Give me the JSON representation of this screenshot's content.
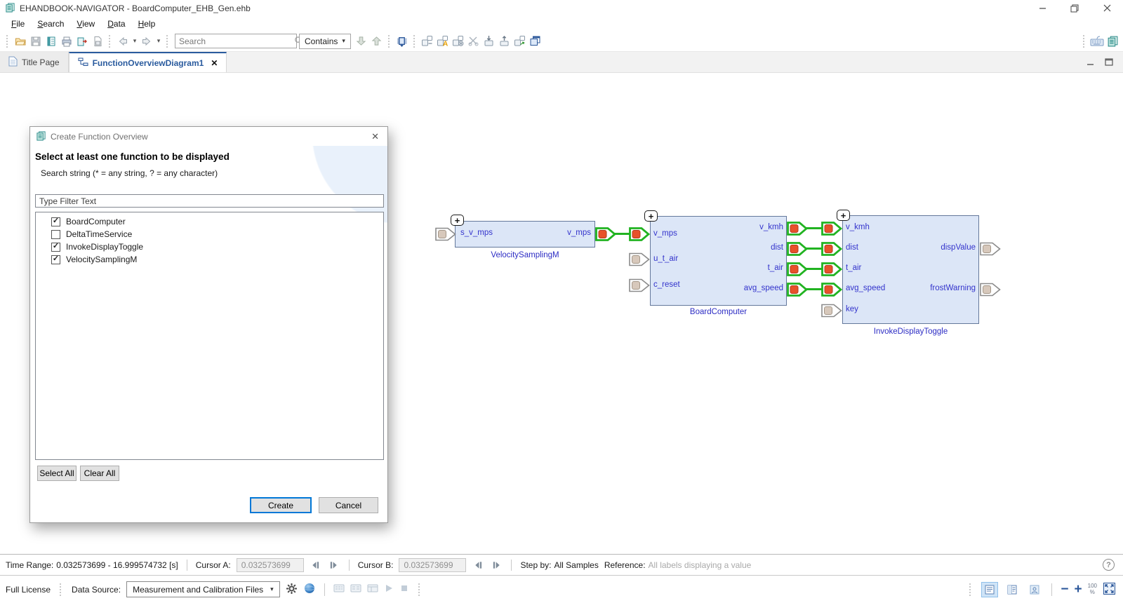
{
  "icons": {
    "close": "✕",
    "caret_down": "▾",
    "plus": "+",
    "help": "?",
    "check": "✓",
    "minimize": "—",
    "maximize": "▢",
    "tab_min": "─",
    "tab_max": "☐",
    "minus": "−",
    "plus_zoom": "+"
  },
  "titlebar": {
    "title": "EHANDBOOK-NAVIGATOR - BoardComputer_EHB_Gen.ehb"
  },
  "menubar": {
    "items": {
      "file": "File",
      "search": "Search",
      "view": "View",
      "data": "Data",
      "help": "Help"
    }
  },
  "toolbar": {
    "search_placeholder": "Search",
    "contains_label": "Contains"
  },
  "tabstrip": {
    "tabs": {
      "title_page": "Title Page",
      "diagram": "FunctionOverviewDiagram1"
    }
  },
  "dialog": {
    "title": "Create Function Overview",
    "heading": "Select at least one function to be displayed",
    "subheading": "Search string (* = any string, ? = any character)",
    "filter_placeholder": "Type Filter Text",
    "functions": [
      {
        "label": "BoardComputer",
        "checked": true
      },
      {
        "label": "DeltaTimeService",
        "checked": false
      },
      {
        "label": "InvokeDisplayToggle",
        "checked": true
      },
      {
        "label": "VelocitySamplingM",
        "checked": true
      }
    ],
    "buttons": {
      "select_all": "Select All",
      "clear_all": "Clear All",
      "create": "Create",
      "cancel": "Cancel"
    }
  },
  "diagram": {
    "blocks": [
      {
        "name": "VelocitySamplingM",
        "inputs": [
          {
            "label": "s_v_mps",
            "connected": false
          }
        ],
        "outputs": [
          {
            "label": "v_mps",
            "connected": true
          }
        ]
      },
      {
        "name": "BoardComputer",
        "inputs": [
          {
            "label": "v_mps",
            "connected": true
          },
          {
            "label": "u_t_air",
            "connected": false
          },
          {
            "label": "c_reset",
            "connected": false
          }
        ],
        "outputs": [
          {
            "label": "v_kmh",
            "connected": true
          },
          {
            "label": "dist",
            "connected": true
          },
          {
            "label": "t_air",
            "connected": true
          },
          {
            "label": "avg_speed",
            "connected": true
          }
        ]
      },
      {
        "name": "InvokeDisplayToggle",
        "inputs": [
          {
            "label": "v_kmh",
            "connected": true
          },
          {
            "label": "dist",
            "connected": true
          },
          {
            "label": "t_air",
            "connected": true
          },
          {
            "label": "avg_speed",
            "connected": true
          },
          {
            "label": "key",
            "connected": false
          }
        ],
        "outputs": [
          {
            "label": "dispValue",
            "connected": false
          },
          {
            "label": "frostWarning",
            "connected": false
          }
        ]
      }
    ],
    "colors": {
      "block_fill": "#dce6f7",
      "block_border": "#64789b",
      "label_color": "#3333cc",
      "connected_green": "#21b321",
      "signal_red": "#e8512a",
      "unconnected_tan": "#d7c8bb"
    }
  },
  "statusbar": {
    "time_range_label": "Time Range:",
    "time_range_value": "0.032573699 - 16.999574732 [s]",
    "cursor_a_label": "Cursor A:",
    "cursor_a_value": "0.032573699",
    "cursor_b_label": "Cursor B:",
    "cursor_b_value": "0.032573699",
    "step_by_label": "Step by:",
    "step_by_value": "All Samples",
    "reference_label": "Reference:",
    "reference_value": "All labels displaying a value"
  },
  "bottombar": {
    "license": "Full License",
    "data_source_label": "Data Source:",
    "data_source_value": "Measurement and Calibration Files",
    "zoom_value": "100",
    "zoom_unit": "%"
  }
}
